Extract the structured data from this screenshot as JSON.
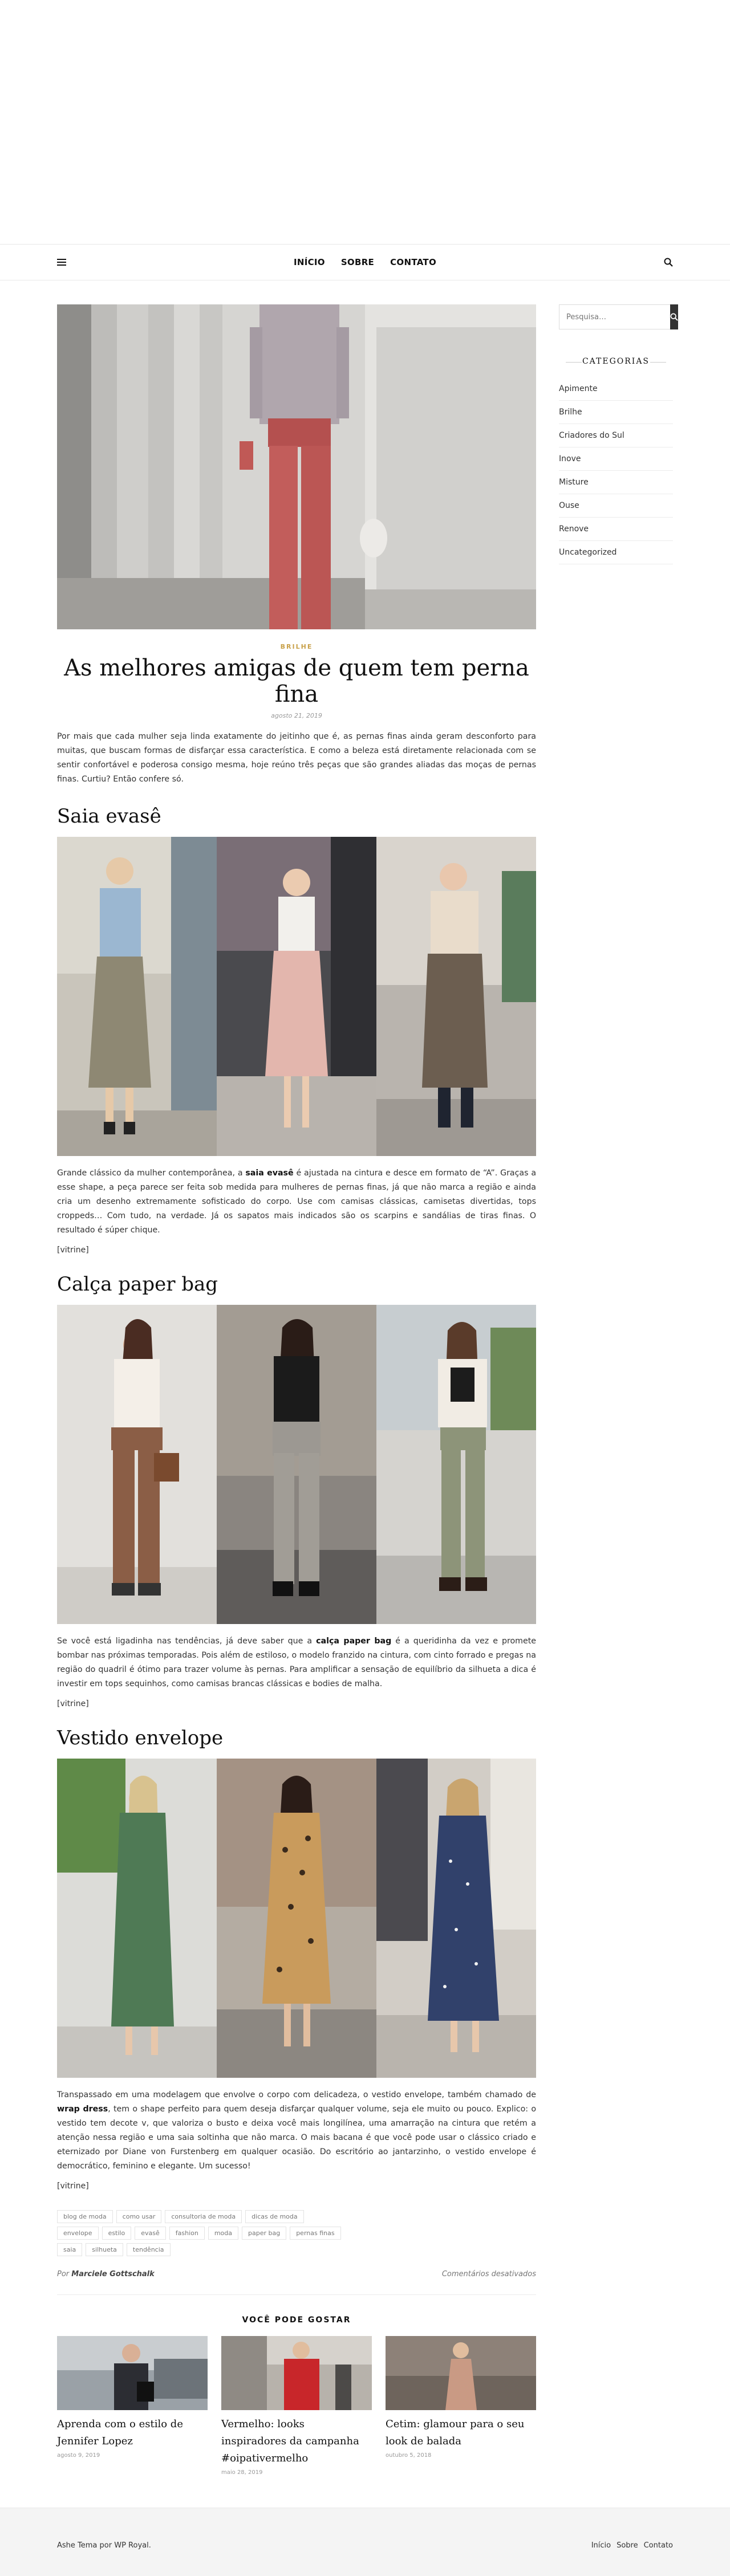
{
  "nav": {
    "links": [
      "INÍCIO",
      "SOBRE",
      "CONTATO"
    ]
  },
  "post": {
    "category": "BRILHE",
    "title": "As melhores amigas de quem tem perna fina",
    "date": "agosto 21, 2019",
    "intro": "Por mais que cada mulher seja linda exatamente do jeitinho que é, as pernas finas ainda geram desconforto para muitas, que buscam formas de disfarçar essa característica. E como a beleza está diretamente relacionada com se sentir confortável e poderosa consigo mesma, hoje reúno três peças que são grandes aliadas das moças de pernas finas. Curtiu? Então confere só.",
    "sections": [
      {
        "title": "Saia evasê",
        "before": "Grande clássico da mulher contemporânea, a ",
        "bold": "saia evasê",
        "after": " é ajustada na cintura e desce em formato de “A”. Graças a esse shape, a peça parece ser feita sob medida para mulheres de pernas finas, já que não marca a região e ainda cria um desenho extremamente sofisticado do corpo. Use com camisas clássicas, camisetas divertidas, tops croppeds… Com tudo, na verdade. Já os sapatos mais indicados são os scarpins e sandálias de tiras finas. O resultado é súper chique.",
        "vitrine": "[vitrine]"
      },
      {
        "title": "Calça paper bag",
        "before": "Se você está ligadinha nas tendências, já deve saber que a ",
        "bold": "calça paper bag",
        "after": " é a queridinha da vez e promete bombar nas próximas temporadas. Pois além de estiloso, o modelo franzido na cintura, com cinto forrado e pregas na região do quadril é ótimo para trazer volume às pernas. Para amplificar a sensação de equilíbrio da silhueta a dica é investir em tops sequinhos, como camisas brancas clássicas e bodies de malha.",
        "vitrine": "[vitrine]"
      },
      {
        "title": "Vestido envelope",
        "before": "Transpassado em uma modelagem que envolve o corpo com delicadeza, o vestido envelope, também chamado de ",
        "bold": "wrap dress",
        "after": ", tem o shape perfeito para quem deseja disfarçar qualquer volume, seja ele muito ou pouco. Explico: o vestido tem decote v, que valoriza o busto e deixa você mais longilínea, uma amarração na cintura que retém a atenção nessa região e uma saia soltinha que não marca. O mais bacana é que você pode usar o clássico criado e eternizado por Diane von Furstenberg em qualquer ocasião. Do escritório ao jantarzinho, o vestido envelope é democrático, feminino e elegante. Um sucesso!",
        "vitrine": "[vitrine]"
      }
    ],
    "tags": [
      "blog de moda",
      "como usar",
      "consultoria de moda",
      "dicas de moda",
      "envelope",
      "estilo",
      "evasê",
      "fashion",
      "moda",
      "paper bag",
      "pernas finas",
      "saia",
      "silhueta",
      "tendência"
    ],
    "author_prefix": "Por",
    "author": "Marciele Gottschalk",
    "comments": "Comentários desativados"
  },
  "related": {
    "heading": "VOCÊ PODE GOSTAR",
    "items": [
      {
        "title": "Aprenda com o estilo de Jennifer Lopez",
        "date": "agosto 9, 2019"
      },
      {
        "title": "Vermelho: looks inspiradores da campanha #oipativermelho",
        "date": "maio 28, 2019"
      },
      {
        "title": "Cetim: glamour para o seu look de balada",
        "date": "outubro 5, 2018"
      }
    ]
  },
  "sidebar": {
    "search_placeholder": "Pesquisa…",
    "categories_title": "CATEGORIAS",
    "categories": [
      "Apimente",
      "Brilhe",
      "Criadores do Sul",
      "Inove",
      "Misture",
      "Ouse",
      "Renove",
      "Uncategorized"
    ]
  },
  "footer": {
    "credit": "Ashe Tema por WP Royal.",
    "links": [
      "Início",
      "Sobre",
      "Contato"
    ]
  }
}
